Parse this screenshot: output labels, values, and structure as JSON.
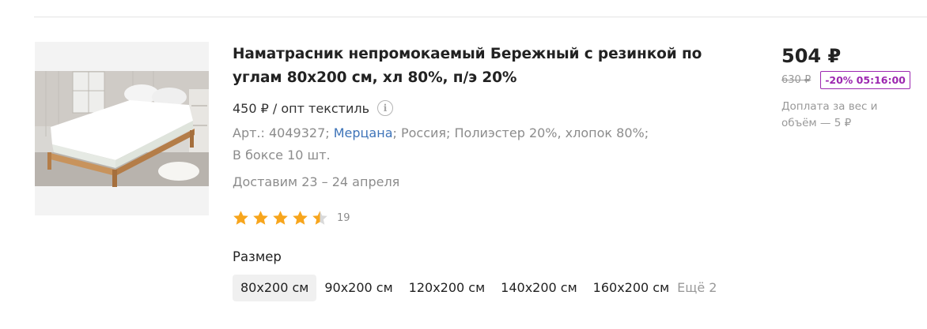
{
  "product": {
    "title": "Наматрасник непромокаемый Бережный с резинкой по углам 80х200 см, хл 80%, п/э 20%",
    "price_per_unit": "450 ₽ / опт текстиль",
    "article": "Арт.: 4049327;",
    "brand": "Мерцана",
    "attributes": "; Россия; Полиэстер 20%, хлопок 80%;",
    "box_qty": "В боксе 10 шт.",
    "delivery": "Доставим 23 – 24 апреля",
    "rating": 4.5,
    "rating_count": "19"
  },
  "pricing": {
    "price": "504 ₽",
    "old_price": "630 ₽",
    "sale_badge": "-20% 05:16:00",
    "surcharge": "Доплата за вес и объём — 5 ₽"
  },
  "sizes": {
    "label": "Размер",
    "options": [
      "80х200 см",
      "90х200 см",
      "120х200 см",
      "140х200 см",
      "160х200 см"
    ],
    "selected_index": 0,
    "more": "Ещё 2"
  },
  "colors": {
    "star": "#f7a51c",
    "star_empty": "#d9d9d9",
    "brand_link": "#3d73b8",
    "badge": "#9c27b0"
  },
  "icons": {
    "info": "i"
  }
}
